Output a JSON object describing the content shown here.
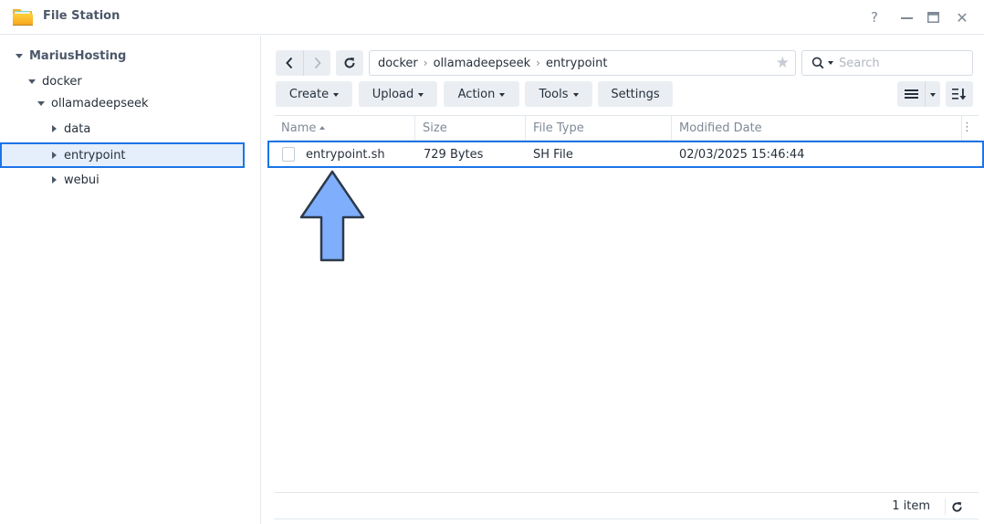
{
  "window": {
    "title": "File Station",
    "controls": {
      "help": "?",
      "minimize": "minimize-icon",
      "maximize": "maximize-icon",
      "close": "✕"
    }
  },
  "sidebar": {
    "tree": [
      {
        "label": "MariusHosting",
        "level": 0,
        "expanded": true,
        "root": true
      },
      {
        "label": "docker",
        "level": 1,
        "expanded": true
      },
      {
        "label": "ollamadeepseek",
        "level": 2,
        "expanded": true
      },
      {
        "label": "data",
        "level": 3,
        "expanded": false
      },
      {
        "label": "entrypoint",
        "level": 3,
        "expanded": false,
        "selected": true
      },
      {
        "label": "webui",
        "level": 3,
        "expanded": false
      }
    ]
  },
  "toolbar": {
    "back": "back-icon",
    "forward": "forward-icon",
    "refresh": "refresh-icon",
    "breadcrumb": [
      "docker",
      "ollamadeepseek",
      "entrypoint"
    ],
    "breadcrumb_separator": "›",
    "favorite": "★",
    "search_placeholder": "Search",
    "buttons": {
      "create": "Create",
      "upload": "Upload",
      "action": "Action",
      "tools": "Tools",
      "settings": "Settings"
    }
  },
  "table": {
    "columns": [
      "Name",
      "Size",
      "File Type",
      "Modified Date"
    ],
    "sort_column": "Name",
    "sort_direction": "ascending",
    "column_menu": "⋮",
    "rows": [
      {
        "name": "entrypoint.sh",
        "size": "729 Bytes",
        "type": "SH File",
        "modified": "02/03/2025 15:46:44",
        "selected": true
      }
    ]
  },
  "footer": {
    "item_count": "1 item"
  },
  "colors": {
    "accent": "#1c74e8",
    "selected_bg": "#e4effb",
    "button_bg": "#eaeef3",
    "arrow_fill": "#7eaefc",
    "arrow_stroke": "#2d3a4a"
  }
}
